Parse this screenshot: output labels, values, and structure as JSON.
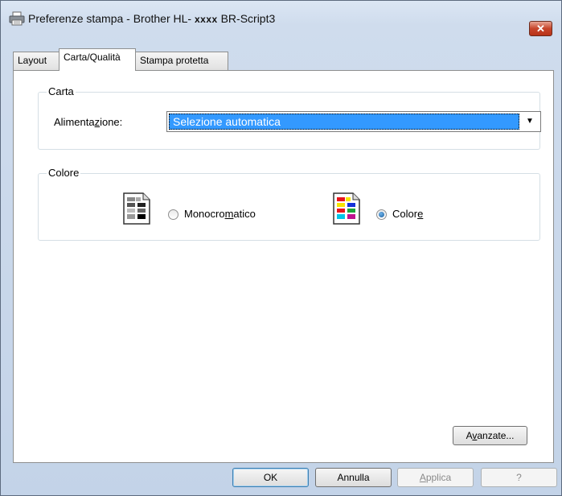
{
  "window": {
    "title_prefix": "Preferenze stampa - Brother HL-",
    "title_model": "xxxx",
    "title_suffix": "BR-Script3",
    "close_label": "✕"
  },
  "tabs": [
    {
      "label": "Layout",
      "active": false
    },
    {
      "label": "Carta/Qualità",
      "active": true
    },
    {
      "label": "Stampa protetta",
      "active": false
    }
  ],
  "carta": {
    "group_label": "Carta",
    "source_label_pre": "Alimenta",
    "source_label_u": "z",
    "source_label_post": "ione:",
    "source_value": "Selezione automatica"
  },
  "colore": {
    "group_label": "Colore",
    "mono_pre": "Monocro",
    "mono_u": "m",
    "mono_post": "atico",
    "color_pre": "Color",
    "color_u": "e",
    "selected": "Colore"
  },
  "buttons": {
    "advanced_pre": "A",
    "advanced_u": "v",
    "advanced_post": "anzate...",
    "ok": "OK",
    "cancel": "Annulla",
    "apply_u": "A",
    "apply_post": "pplica",
    "help": "?"
  }
}
